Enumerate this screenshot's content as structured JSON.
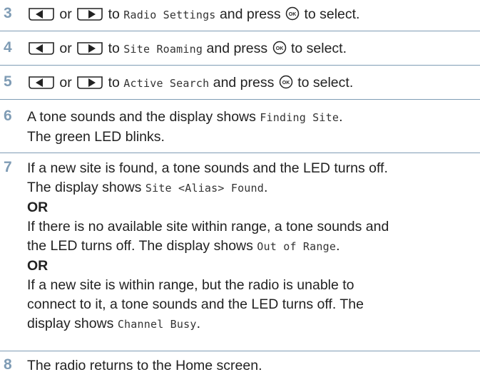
{
  "steps": [
    {
      "number": "3",
      "or": "or",
      "to": "to",
      "target": "Radio Settings",
      "press": "and press",
      "select": "to select."
    },
    {
      "number": "4",
      "or": "or",
      "to": "to",
      "target": "Site Roaming",
      "press": "and press",
      "select": "to select."
    },
    {
      "number": "5",
      "or": "or",
      "to": "to",
      "target": "Active Search",
      "press": "and press",
      "select": "to select."
    },
    {
      "number": "6",
      "line1_pre": "A tone sounds and the display shows",
      "line1_code": "Finding Site",
      "line1_post": ".",
      "line2": "The green LED blinks."
    },
    {
      "number": "7",
      "p1_line1": "If a new site is found, a tone sounds and the LED turns off.",
      "p1_line2_pre": "The display shows",
      "p1_line2_code": "Site <Alias> Found",
      "p1_line2_post": ".",
      "or1": "OR",
      "p2_line1": "If there is no available site within range, a tone sounds and",
      "p2_line2_pre": "the LED turns off. The display shows",
      "p2_line2_code": "Out of Range",
      "p2_line2_post": ".",
      "or2": "OR",
      "p3_line1": "If a new site is within range, but the radio is unable to",
      "p3_line2": "connect to it, a tone sounds and the LED turns off. The",
      "p3_line3_pre": "display shows",
      "p3_line3_code": "Channel Busy",
      "p3_line3_post": "."
    },
    {
      "number": "8",
      "line1": "The radio returns to the Home screen."
    }
  ],
  "icons": {
    "left_key": "left-arrow-key-icon",
    "right_key": "right-arrow-key-icon",
    "ok_key": "ok-button-icon"
  },
  "colors": {
    "step_number": "#7f9cb5",
    "rule": "#7f9cb5",
    "text": "#222222"
  }
}
